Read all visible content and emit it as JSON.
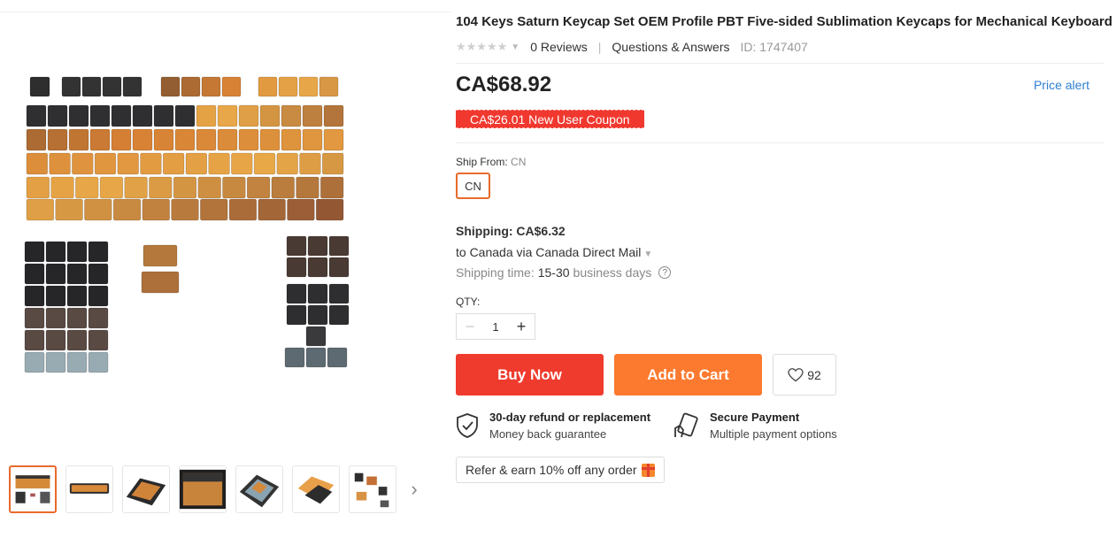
{
  "product": {
    "title": "104 Keys Saturn Keycap Set OEM Profile PBT Five-sided Sublimation Keycaps for Mechanical Keyboard",
    "stars": "★★★★★",
    "reviews": "0 Reviews",
    "qa": "Questions & Answers",
    "id": "ID: 1747407",
    "price": "CA$68.92",
    "price_alert": "Price alert",
    "coupon": "CA$26.01 New User Coupon"
  },
  "shipping": {
    "ship_from_label": "Ship From:",
    "ship_from_value": "CN",
    "option": "CN",
    "cost": "Shipping: CA$6.32",
    "via": "to Canada via Canada Direct Mail",
    "time_label": "Shipping time:",
    "time_days": "15-30",
    "time_suffix": "business days",
    "help": "?"
  },
  "quantity": {
    "label": "QTY:",
    "value": "1",
    "minus": "−",
    "plus": "+"
  },
  "actions": {
    "buy_now": "Buy Now",
    "add_to_cart": "Add to Cart",
    "wishlist_count": "92"
  },
  "guarantees": [
    {
      "title": "30-day refund or replacement",
      "sub": "Money back guarantee",
      "icon": "shield-check-icon"
    },
    {
      "title": "Secure Payment",
      "sub": "Multiple payment options",
      "icon": "card-hand-icon"
    }
  ],
  "refer": "Refer & earn 10% off any order",
  "gallery": {
    "next": "›",
    "thumb_count": 7
  },
  "colors": {
    "accent": "#e86a2c",
    "buy": "#ef3b2d",
    "cart": "#fc7a2f",
    "coupon": "#f0382f",
    "link": "#2e7fd1"
  }
}
